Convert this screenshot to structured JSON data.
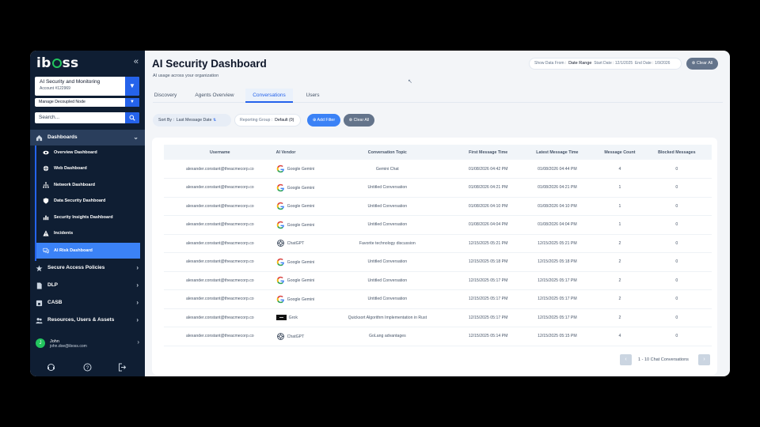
{
  "colors": {
    "sidebar": "#0f1e33",
    "accent": "#2563eb",
    "active": "#3b82f6",
    "logo_green": "#22c55e"
  },
  "sidebar": {
    "logo_pre": "ib",
    "logo_post": "ss",
    "collapse_icon": "double-chevron-left-icon",
    "account_name": "AI Security and Monitoring",
    "account_id": "Account #122969",
    "node_label": "Manage Decoupled Node",
    "search_placeholder": "Search...",
    "dashboards_label": "Dashboards",
    "sub_items": [
      {
        "label": "Overview Dashboard",
        "icon": "eye-icon"
      },
      {
        "label": "Web Dashboard",
        "icon": "globe-icon"
      },
      {
        "label": "Network Dashboard",
        "icon": "network-icon"
      },
      {
        "label": "Data Security Dashboard",
        "icon": "shield-icon"
      },
      {
        "label": "Security Insights Dashboard",
        "icon": "chart-icon"
      },
      {
        "label": "Incidents",
        "icon": "warning-icon"
      },
      {
        "label": "AI Risk Dashboard",
        "icon": "chat-icon"
      }
    ],
    "sections": [
      {
        "label": "Secure Access Policies",
        "icon": "star-icon"
      },
      {
        "label": "DLP",
        "icon": "file-icon"
      },
      {
        "label": "CASB",
        "icon": "cloud-lock-icon"
      },
      {
        "label": "Resources, Users & Assets",
        "icon": "users-icon"
      }
    ],
    "user": {
      "initial": "J",
      "name": "John",
      "email": "john.doe@iboss.com"
    }
  },
  "header": {
    "title": "AI Security Dashboard",
    "subtitle": "AI usage across your organization",
    "show_data_from": "Show Data From :",
    "date_range": "Date Range",
    "start_label": "Start Date :",
    "start_value": "12/1/2025",
    "end_label": "End Date :",
    "end_value": "1/9/2026",
    "clear_all": "Clear All"
  },
  "tabs": [
    "Discovery",
    "Agents Overview",
    "Conversations",
    "Users"
  ],
  "filters": {
    "sort_label": "Sort By :",
    "sort_value": "Last Message Date",
    "reporting_label": "Reporting Group :",
    "reporting_value": "Default (0)",
    "add_filter": "Add Filter",
    "clear_all": "Clear All"
  },
  "table": {
    "headers": [
      "Username",
      "AI Vendor",
      "Conversation Topic",
      "First Message Time",
      "Latest Message Time",
      "Message Count",
      "Blocked Messages"
    ],
    "rows": [
      [
        "alexander.constant@theacmecorp.co",
        "Google Gemini",
        "Gemini Chat",
        "01/08/2026 04:42 PM",
        "01/08/2026 04:44 PM",
        "4",
        "0"
      ],
      [
        "alexander.constant@theacmecorp.co",
        "Google Gemini",
        "Untitled Conversation",
        "01/08/2026 04:21 PM",
        "01/08/2026 04:21 PM",
        "1",
        "0"
      ],
      [
        "alexander.constant@theacmecorp.co",
        "Google Gemini",
        "Untitled Conversation",
        "01/08/2026 04:10 PM",
        "01/08/2026 04:10 PM",
        "1",
        "0"
      ],
      [
        "alexander.constant@theacmecorp.co",
        "Google Gemini",
        "Untitled Conversation",
        "01/08/2026 04:04 PM",
        "01/08/2026 04:04 PM",
        "1",
        "0"
      ],
      [
        "alexander.constant@theacmecorp.co",
        "ChatGPT",
        "Favorite technology discussion",
        "12/15/2025 05:21 PM",
        "12/15/2025 05:21 PM",
        "2",
        "0"
      ],
      [
        "alexander.constant@theacmecorp.co",
        "Google Gemini",
        "Untitled Conversation",
        "12/15/2025 05:18 PM",
        "12/15/2025 05:18 PM",
        "2",
        "0"
      ],
      [
        "alexander.constant@theacmecorp.co",
        "Google Gemini",
        "Untitled Conversation",
        "12/15/2025 05:17 PM",
        "12/15/2025 05:17 PM",
        "2",
        "0"
      ],
      [
        "alexander.constant@theacmecorp.co",
        "Google Gemini",
        "Untitled Conversation",
        "12/15/2025 05:17 PM",
        "12/15/2025 05:17 PM",
        "2",
        "0"
      ],
      [
        "alexander.constant@theacmecorp.co",
        "Grok",
        "Quicksort Algorithm Implementation in Rust",
        "12/15/2025 05:17 PM",
        "12/15/2025 05:17 PM",
        "2",
        "0"
      ],
      [
        "alexander.constant@theacmecorp.co",
        "ChatGPT",
        "GoLang advantages",
        "12/15/2025 05:14 PM",
        "12/15/2025 05:15 PM",
        "4",
        "0"
      ]
    ]
  },
  "pagination": {
    "text": "1 - 10 Chat Conversations"
  }
}
